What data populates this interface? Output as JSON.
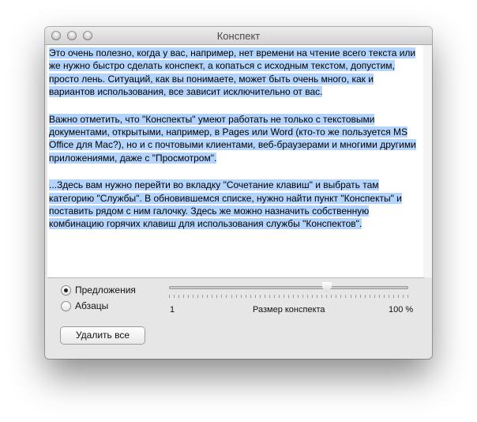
{
  "window": {
    "title": "Конспект"
  },
  "content": {
    "paragraphs": [
      "Это очень полезно, когда у вас, например, нет времени на чтение всего текста или же нужно быстро сделать конспект, а копаться с исходным текстом, допустим, просто лень.  Ситуаций, как вы понимаете, может быть очень много, как и вариантов использования, все зависит исключительно от вас.",
      "Важно отметить, что \"Конспекты\" умеют работать не только с текстовыми документами, открытыми, например, в Pages или Word (кто-то же пользуется MS Office для Mac?), но и с почтовыми клиентами, веб-браузерами и многими другими приложениями, даже с \"Просмотром\".",
      "...Здесь вам нужно перейти во вкладку \"Сочетание клавиш\" и выбрать там категорию \"Службы\".  В обновившемся списке, нужно найти пункт \"Конспекты\" и поставить рядом с ним галочку.  Здесь же можно назначить собственную комбинацию горячих клавиш для использования службы \"Конспектов\"."
    ]
  },
  "controls": {
    "mode_options": [
      "Предложения",
      "Абзацы"
    ],
    "selected_mode": "Предложения",
    "slider": {
      "min_label": "1",
      "caption": "Размер конспекта",
      "max_label": "100 %",
      "value_fraction": 0.66
    },
    "clear_button": "Удалить все"
  },
  "colors": {
    "selection": "#b3d4fc",
    "window_bg": "#e6e6e6"
  },
  "icons": [
    "close-button-icon",
    "minimize-button-icon",
    "zoom-button-icon",
    "slider-knob-icon"
  ]
}
